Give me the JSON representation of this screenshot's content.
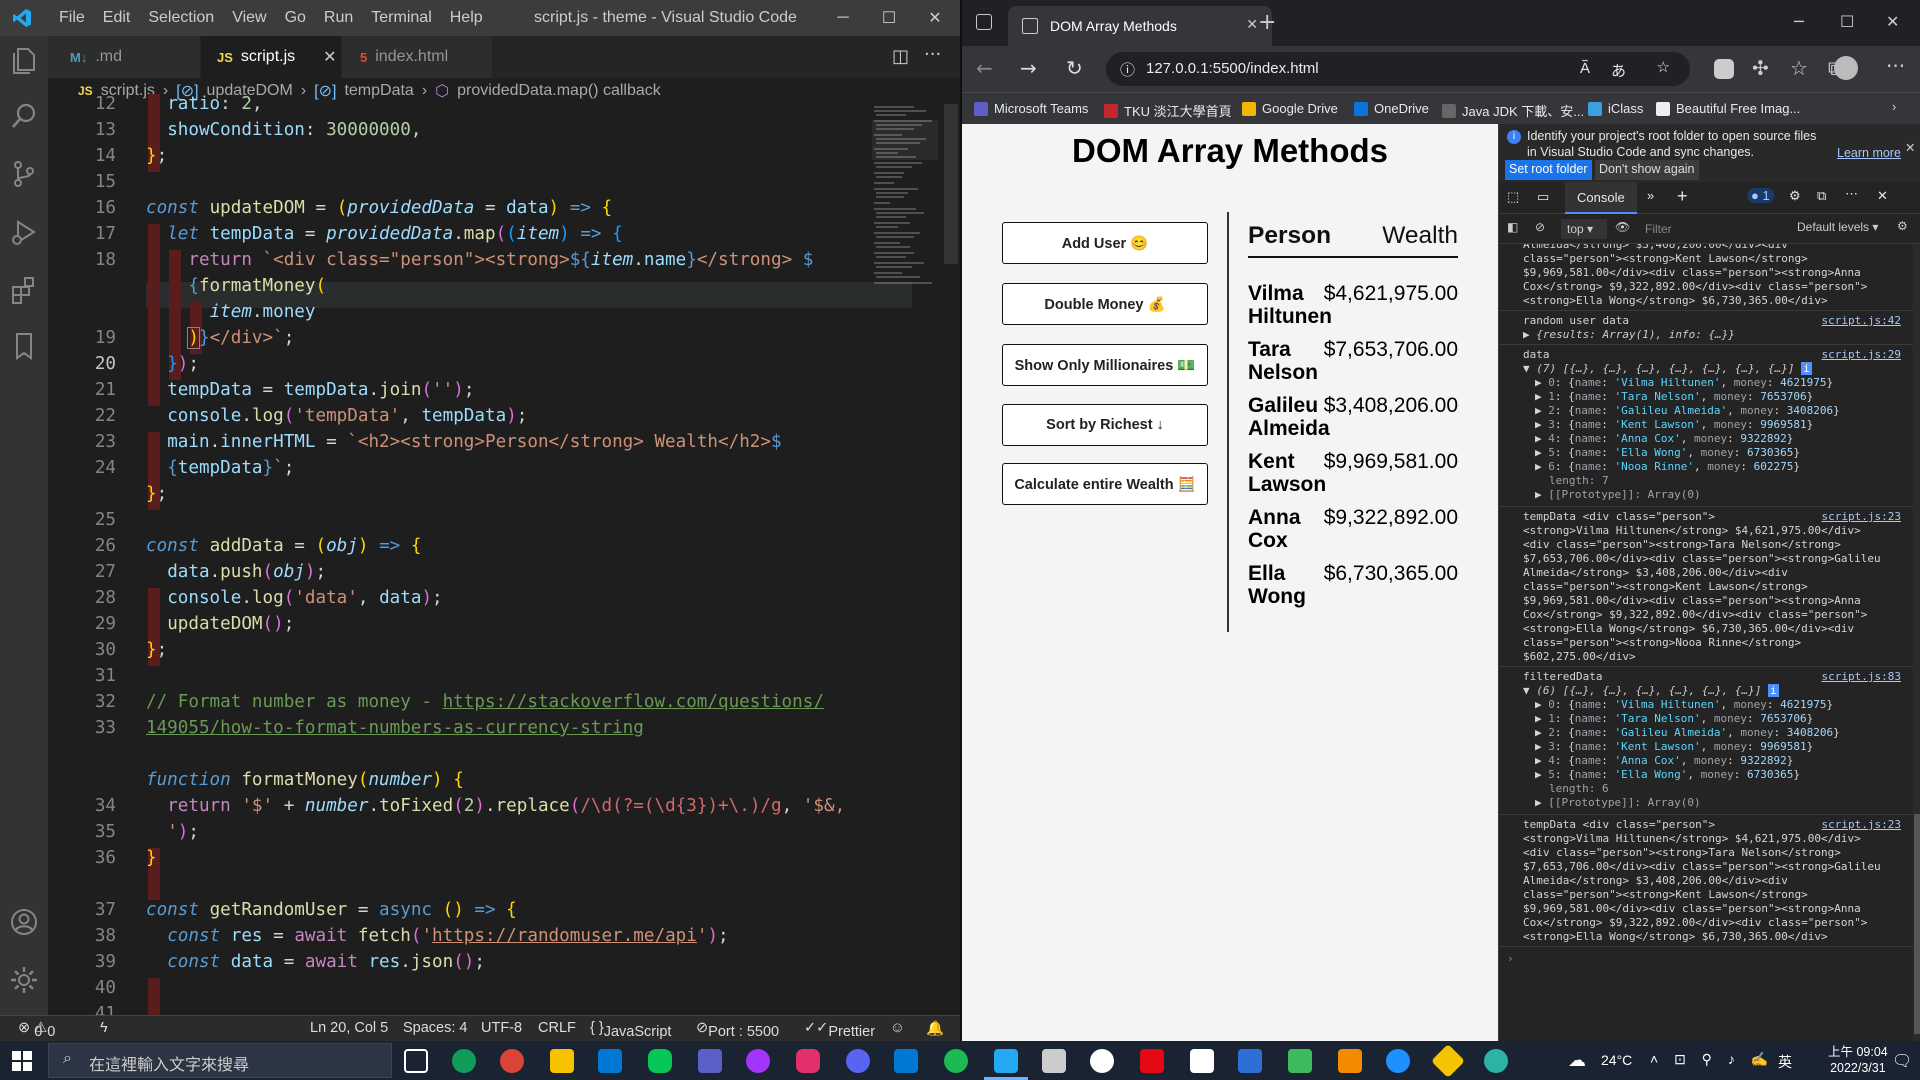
{
  "vscode": {
    "menu": [
      "File",
      "Edit",
      "Selection",
      "View",
      "Go",
      "Run",
      "Terminal",
      "Help"
    ],
    "window_title": "script.js - theme - Visual Studio Code",
    "tabs": [
      {
        "icon": "M↓",
        "label": ".md"
      },
      {
        "icon": "JS",
        "label": "script.js"
      },
      {
        "icon": "5",
        "label": "index.html"
      }
    ],
    "breadcrumb": [
      "script.js",
      "updateDOM",
      "tempData",
      "providedData.map() callback"
    ],
    "line_numbers": [
      "12",
      "13",
      "14",
      "15",
      "16",
      "17",
      "18",
      "",
      "19",
      "20",
      "21",
      "22",
      "23",
      "24",
      "",
      "25",
      "26",
      "27",
      "28",
      "29",
      "30",
      "31",
      "32",
      "33",
      "",
      "34",
      "35",
      "36",
      "",
      "37",
      "38",
      "39",
      "40",
      "41"
    ],
    "comment_url_1": "https://stackoverflow.com/questions/",
    "comment_url_2": "149055/how-to-format-numbers-as-currency-string",
    "fetch_url": "https://randomuser.me/api",
    "status": {
      "errors": "0",
      "warnings": "0",
      "position": "Ln 20, Col 5",
      "spaces": "Spaces: 4",
      "encoding": "UTF-8",
      "eol": "CRLF",
      "language": "JavaScript",
      "port": "Port : 5500",
      "formatter": "Prettier"
    }
  },
  "browser": {
    "tab_title": "DOM Array Methods",
    "url": "127.0.0.1:5500/index.html",
    "bookmarks": [
      "Microsoft Teams",
      "TKU 淡江大學首頁",
      "Google Drive",
      "OneDrive",
      "Java JDK 下載、安...",
      "iClass",
      "Beautiful Free Imag..."
    ]
  },
  "page": {
    "title": "DOM Array Methods",
    "buttons": [
      "Add User 😊",
      "Double Money 💰",
      "Show Only Millionaires 💵",
      "Sort by Richest ↓",
      "Calculate entire Wealth 🧮"
    ],
    "header_person": "Person",
    "header_wealth": "Wealth",
    "rows": [
      {
        "first": "Vilma",
        "last": "Hiltunen",
        "wealth": "$4,621,975.00"
      },
      {
        "first": "Tara",
        "last": "Nelson",
        "wealth": "$7,653,706.00"
      },
      {
        "first": "Galileu",
        "last": "Almeida",
        "wealth": "$3,408,206.00"
      },
      {
        "first": "Kent",
        "last": "Lawson",
        "wealth": "$9,969,581.00"
      },
      {
        "first": "Anna",
        "last": "Cox",
        "wealth": "$9,322,892.00"
      },
      {
        "first": "Ella",
        "last": "Wong",
        "wealth": "$6,730,365.00"
      }
    ]
  },
  "devtools": {
    "info_text": "Identify your project's root folder to open source files in Visual Studio Code and sync changes.",
    "learn_more": "Learn more",
    "set_root": "Set root folder",
    "dont_show": "Don't show again",
    "tab_console": "Console",
    "issues_count": "1",
    "context": "top",
    "filter_placeholder": "Filter",
    "levels": "Default levels",
    "log_random_label": "random user data",
    "log_random_src": "script.js:42",
    "log_random_obj": "{results: Array(1), info: {…}}",
    "log_data_label": "data",
    "log_data_src": "script.js:29",
    "log_data_summary": "(7) [{…}, {…}, {…}, {…}, {…}, {…}, {…}]",
    "data_items": [
      {
        "i": "0",
        "name": "'Vilma Hiltunen'",
        "money": "4621975"
      },
      {
        "i": "1",
        "name": "'Tara Nelson'",
        "money": "7653706"
      },
      {
        "i": "2",
        "name": "'Galileu Almeida'",
        "money": "3408206"
      },
      {
        "i": "3",
        "name": "'Kent Lawson'",
        "money": "9969581"
      },
      {
        "i": "4",
        "name": "'Anna Cox'",
        "money": "9322892"
      },
      {
        "i": "5",
        "name": "'Ella Wong'",
        "money": "6730365"
      },
      {
        "i": "6",
        "name": "'Nooa Rinne'",
        "money": "602275"
      }
    ],
    "data_length": "length: 7",
    "prototype": "[[Prototype]]: Array(0)",
    "log_temp_src": "script.js:23",
    "log_filtered_label": "filteredData",
    "log_filtered_src": "script.js:83",
    "log_filtered_summary": "(6) [{…}, {…}, {…}, {…}, {…}, {…}]",
    "filtered_length": "length: 6",
    "top_lines": [
      "Almeida</strong> $3,408,206.00</div><div",
      "class=\"person\"><strong>Kent Lawson</strong>",
      "$9,969,581.00</div><div class=\"person\"><strong>Anna",
      "Cox</strong> $9,322,892.00</div><div class=\"person\">",
      "<strong>Ella Wong</strong> $6,730,365.00</div>"
    ],
    "temp1_lines": [
      "tempData <div class=\"person\">",
      "<strong>Vilma Hiltunen</strong> $4,621,975.00</div>",
      "<div class=\"person\"><strong>Tara Nelson</strong>",
      "$7,653,706.00</div><div class=\"person\"><strong>Galileu",
      "Almeida</strong> $3,408,206.00</div><div",
      "class=\"person\"><strong>Kent Lawson</strong>",
      "$9,969,581.00</div><div class=\"person\"><strong>Anna",
      "Cox</strong> $9,322,892.00</div><div class=\"person\">",
      "<strong>Ella Wong</strong> $6,730,365.00</div><div",
      "class=\"person\"><strong>Nooa Rinne</strong>",
      "$602,275.00</div>"
    ],
    "temp2_lines": [
      "tempData <div class=\"person\">",
      "<strong>Vilma Hiltunen</strong> $4,621,975.00</div>",
      "<div class=\"person\"><strong>Tara Nelson</strong>",
      "$7,653,706.00</div><div class=\"person\"><strong>Galileu",
      "Almeida</strong> $3,408,206.00</div><div",
      "class=\"person\"><strong>Kent Lawson</strong>",
      "$9,969,581.00</div><div class=\"person\"><strong>Anna",
      "Cox</strong> $9,322,892.00</div><div class=\"person\">",
      "<strong>Ella Wong</strong> $6,730,365.00</div>"
    ]
  },
  "taskbar": {
    "search_placeholder": "在這裡輸入文字來搜尋",
    "temperature": "24°C",
    "ime": "英",
    "time": "上午 09:04",
    "date": "2022/3/31"
  }
}
